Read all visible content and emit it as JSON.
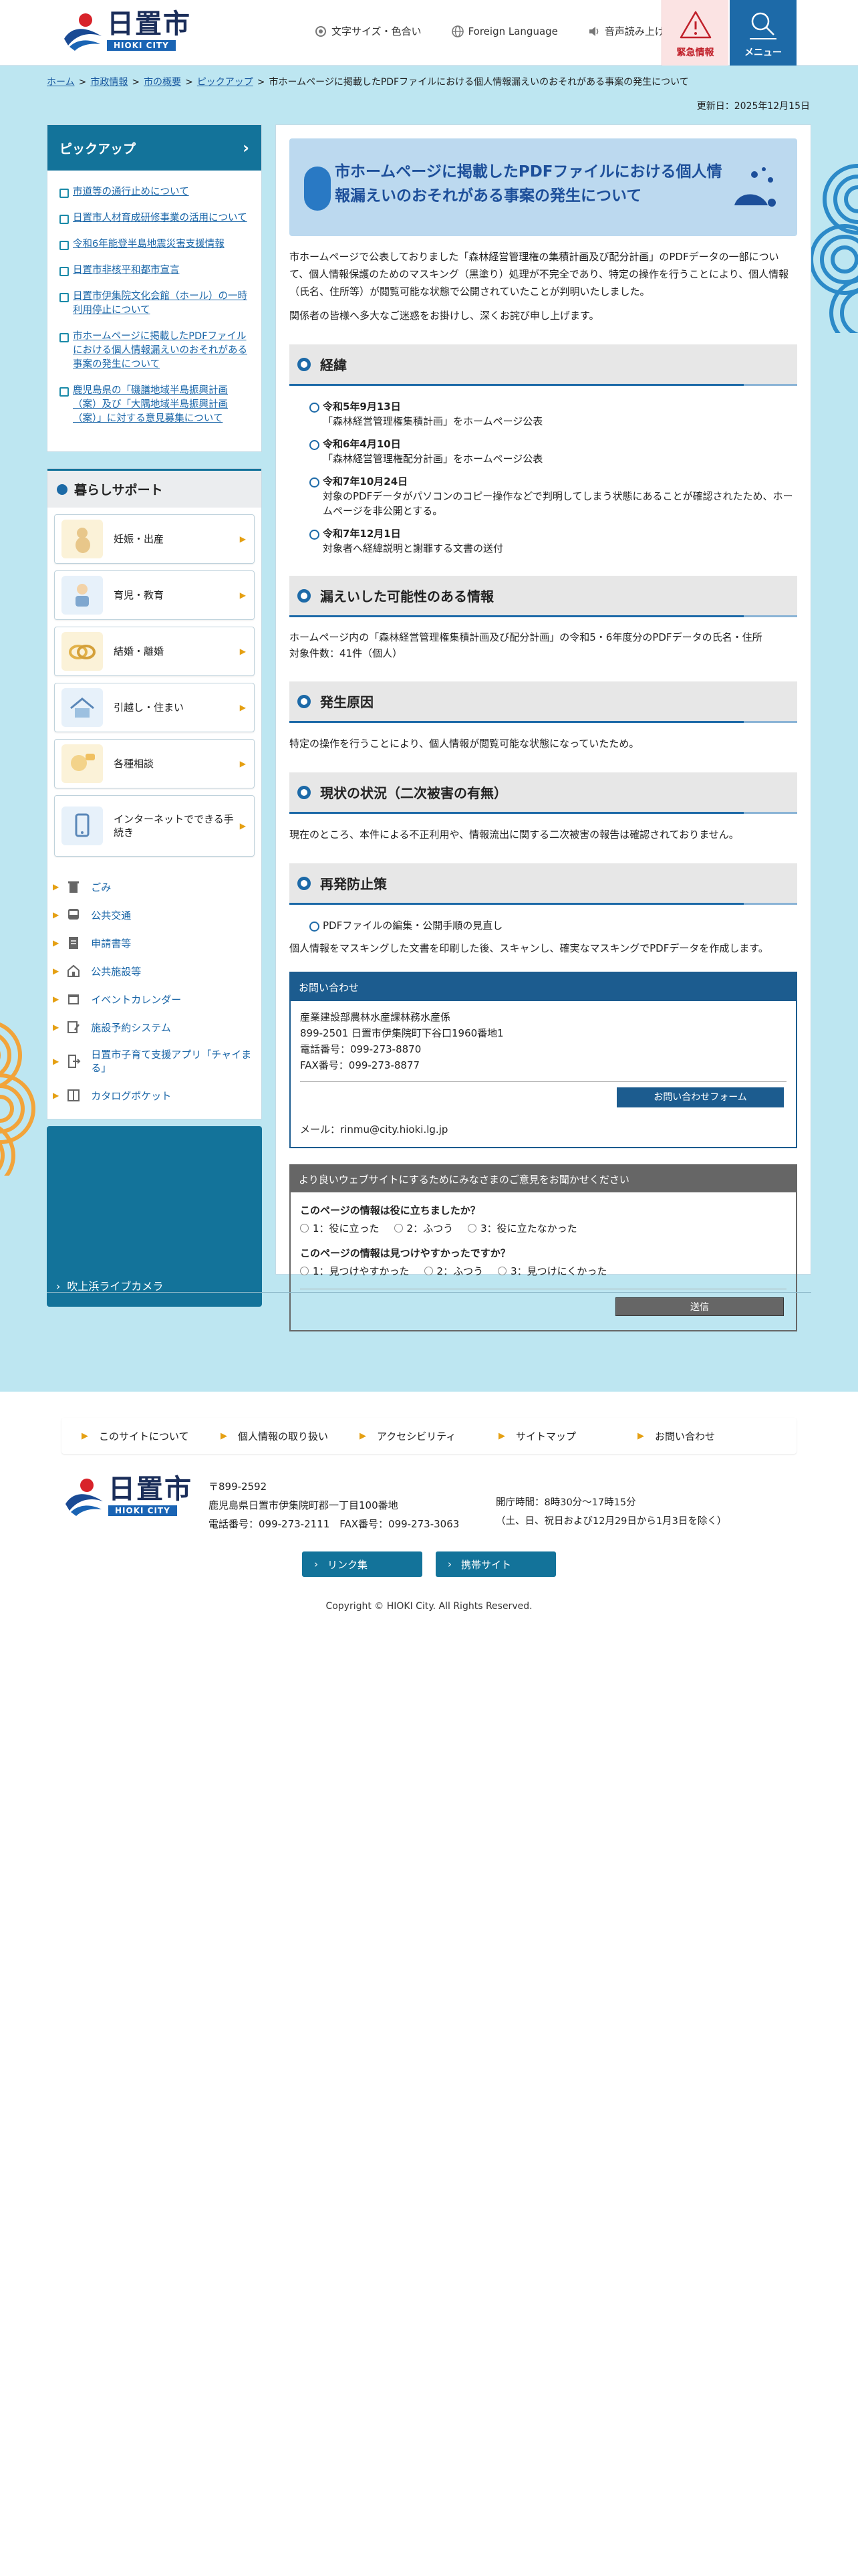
{
  "header": {
    "logo_name": "日置市",
    "logo_en": "HIOKI CITY",
    "util": {
      "font_color": "文字サイズ・色合い",
      "language": "Foreign Language",
      "voice": "音声読み上げ"
    },
    "emergency": "緊急情報",
    "menu": "メニュー"
  },
  "breadcrumb": {
    "items": [
      "ホーム",
      "市政情報",
      "市の概要",
      "ピックアップ"
    ],
    "current": "市ホームページに掲載したPDFファイルにおける個人情報漏えいのおそれがある事案の発生について",
    "sep": ">"
  },
  "updated": "更新日：2025年12月15日",
  "sidebar": {
    "pickup_title": "ピックアップ",
    "pickup_items": [
      "市道等の通行止めについて",
      "日置市人材育成研修事業の活用について",
      "令和6年能登半島地震災害支援情報",
      "日置市非核平和都市宣言",
      "日置市伊集院文化会館（ホール）の一時利用停止について",
      "市ホームページに掲載したPDFファイルにおける個人情報漏えいのおそれがある事案の発生について",
      "鹿児島県の「磯膳地域半島振興計画（案）及び「大隅地域半島振興計画（案）」に対する意見募集について"
    ],
    "support_title": "暮らしサポート",
    "support_items": [
      "妊娠・出産",
      "育児・教育",
      "結婚・離婚",
      "引越し・住まい",
      "各種相談",
      "インターネットでできる手続き"
    ],
    "small_links": [
      "ごみ",
      "公共交通",
      "申請書等",
      "公共施設等",
      "イベントカレンダー",
      "施設予約システム",
      "日置市子育て支援アプリ「チャイまる」",
      "カタログポケット"
    ],
    "live_camera": "吹上浜ライブカメラ"
  },
  "content": {
    "title": "市ホームページに掲載したPDFファイルにおける個人情報漏えいのおそれがある事案の発生について",
    "intro": "市ホームページで公表しておりました「森林経営管理権の集積計画及び配分計画」のPDFデータの一部について、個人情報保護のためのマスキング（黒塗り）処理が不完全であり、特定の操作を行うことにより、個人情報（氏名、住所等）が閲覧可能な状態で公開されていたことが判明いたしました。",
    "apology": "関係者の皆様へ多大なご迷惑をお掛けし、深くお詫び申し上げます。",
    "sec1": "経緯",
    "timeline": [
      {
        "date": "令和5年9月13日",
        "text": "「森林経営管理権集積計画」をホームページ公表"
      },
      {
        "date": "令和6年4月10日",
        "text": "「森林経営管理権配分計画」をホームページ公表"
      },
      {
        "date": "令和7年10月24日",
        "text": "対象のPDFデータがパソコンのコピー操作などで判明してしまう状態にあることが確認されたため、ホームページを非公開とする。"
      },
      {
        "date": "令和7年12月1日",
        "text": "対象者へ経緯説明と謝罪する文書の送付"
      }
    ],
    "sec2": "漏えいした可能性のある情報",
    "leak_info_1": "ホームページ内の「森林経営管理権集積計画及び配分計画」の令和5・6年度分のPDFデータの氏名・住所",
    "leak_info_2": "対象件数：41件（個人）",
    "sec3": "発生原因",
    "cause": "特定の操作を行うことにより、個人情報が閲覧可能な状態になっていたため。",
    "sec4": "現状の状況（二次被害の有無）",
    "status": "現在のところ、本件による不正利用や、情報流出に関する二次被害の報告は確認されておりません。",
    "sec5": "再発防止策",
    "prevention_item": "PDFファイルの編集・公開手順の見直し",
    "prevention_text": "個人情報をマスキングした文書を印刷した後、スキャンし、確実なマスキングでPDFデータを作成します。",
    "contact": {
      "head": "お問い合わせ",
      "dept": "産業建設部農林水産課林務水産係",
      "address": "899-2501 日置市伊集院町下谷口1960番地1",
      "tel": "電話番号：099-273-8870",
      "fax": "FAX番号：099-273-8877",
      "form_button": "お問い合わせフォーム",
      "mail": "メール：rinmu@city.hioki.lg.jp"
    },
    "survey": {
      "head": "より良いウェブサイトにするためにみなさまのご意見をお聞かせください",
      "q1": "このページの情報は役に立ちましたか？",
      "q1_opts": [
        "1：役に立った",
        "2：ふつう",
        "3：役に立たなかった"
      ],
      "q2": "このページの情報は見つけやすかったですか？",
      "q2_opts": [
        "1：見つけやすかった",
        "2：ふつう",
        "3：見つけにくかった"
      ],
      "send": "送信"
    }
  },
  "footer": {
    "nav": [
      "このサイトについて",
      "個人情報の取り扱い",
      "アクセシビリティ",
      "サイトマップ",
      "お問い合わせ"
    ],
    "postal": "〒899-2592",
    "address": "鹿児島県日置市伊集院町郡一丁目100番地",
    "phone": "電話番号：099-273-2111　FAX番号：099-273-3063",
    "hours": "開庁時間：8時30分～17時15分",
    "holidays": "（土、日、祝日および12月29日から1月3日を除く）",
    "btn_links": "リンク集",
    "btn_mobile": "携帯サイト",
    "copyright": "Copyright © HIOKI City. All Rights Reserved."
  }
}
